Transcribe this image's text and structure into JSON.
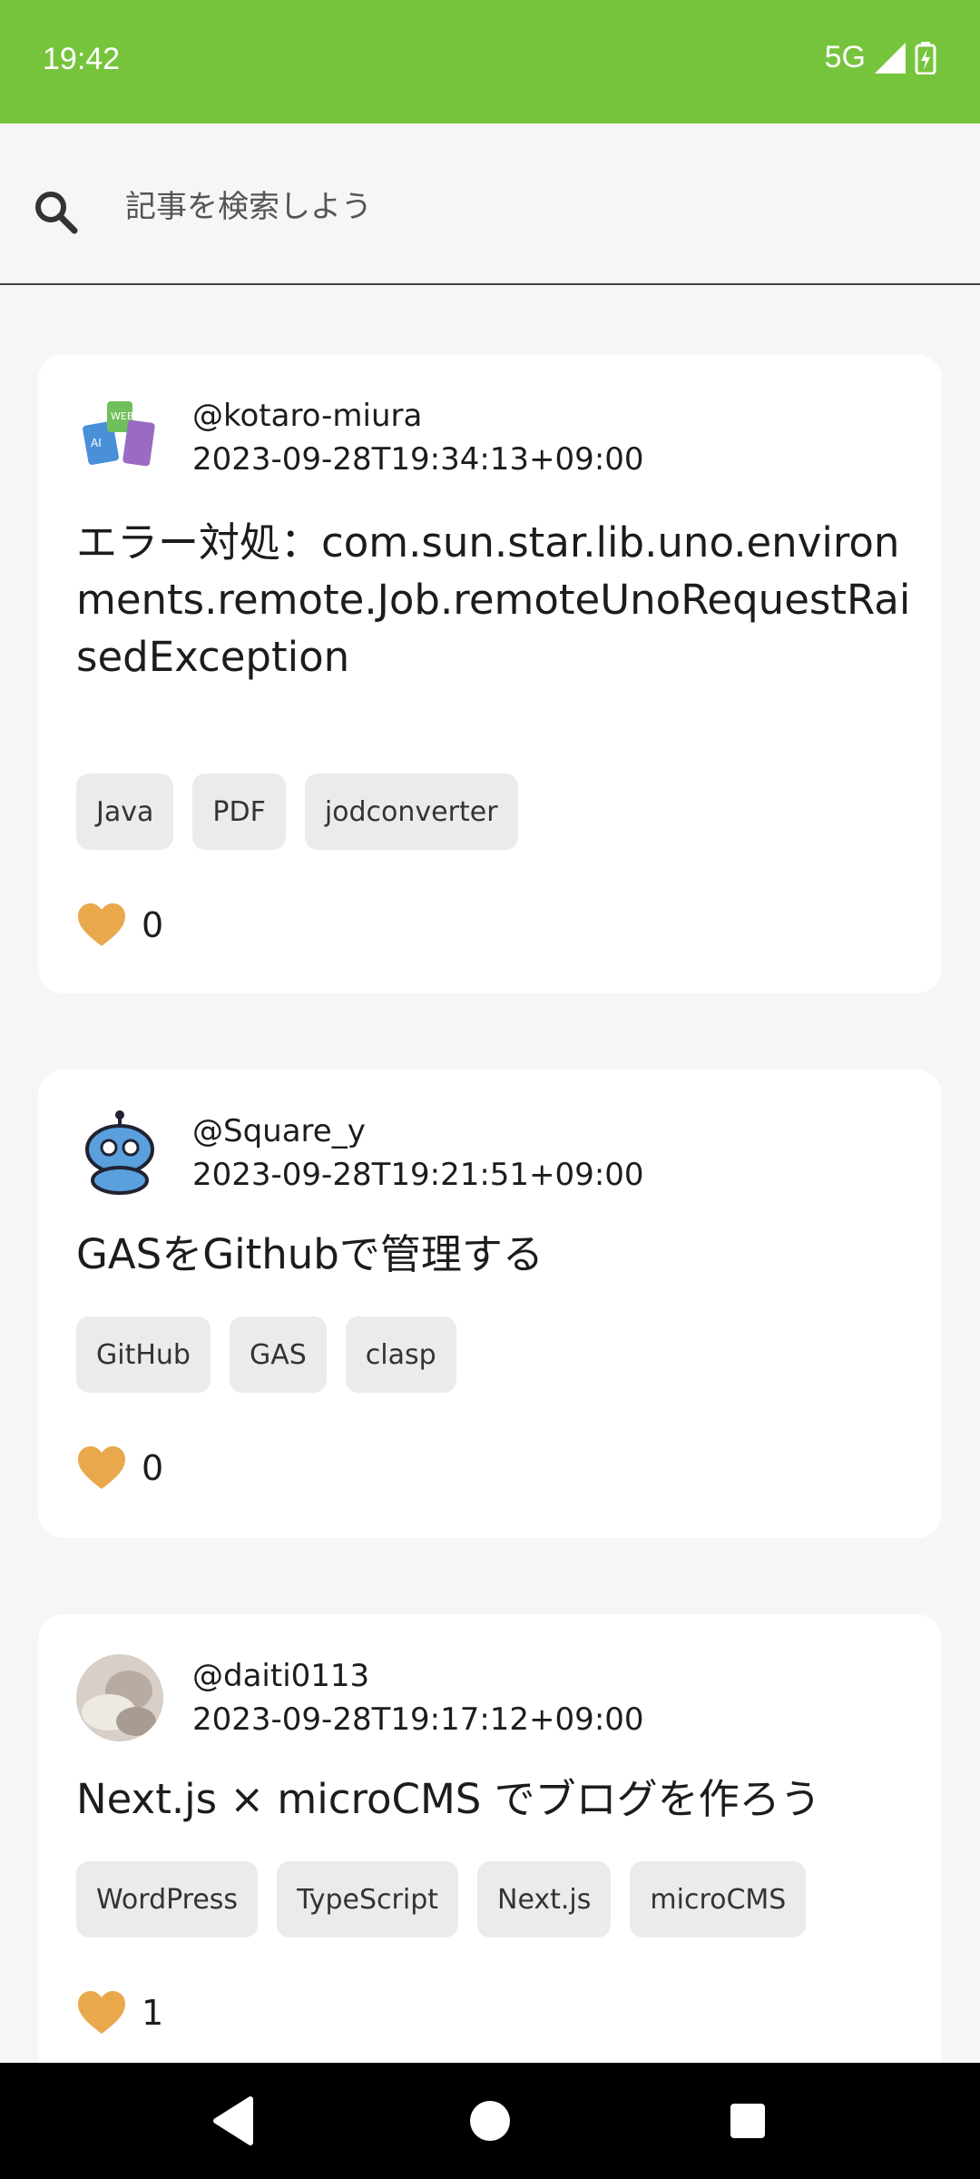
{
  "status_bar": {
    "time": "19:42",
    "network": "5G",
    "background_color": "#76c43c"
  },
  "search": {
    "placeholder": "記事を検索しよう",
    "value": ""
  },
  "posts": [
    {
      "user": "@kotaro-miura",
      "date": "2023-09-28T19:34:13+09:00",
      "title": "エラー対処：com.sun.star.lib.uno.environments.remote.Job.remoteUnoRequestRaisedException",
      "tags": [
        "Java",
        "PDF",
        "jodconverter"
      ],
      "likes": "0"
    },
    {
      "user": "@Square_y",
      "date": "2023-09-28T19:21:51+09:00",
      "title": "GASをGithubで管理する",
      "tags": [
        "GitHub",
        "GAS",
        "clasp"
      ],
      "likes": "0"
    },
    {
      "user": "@daiti0113",
      "date": "2023-09-28T19:17:12+09:00",
      "title": "Next.js × microCMS でブログを作ろう",
      "tags": [
        "WordPress",
        "TypeScript",
        "Next.js",
        "microCMS"
      ],
      "likes": "1"
    }
  ],
  "colors": {
    "like_heart": "#e9a84c",
    "tag_background": "#ebebeb"
  },
  "icons": {
    "search": "search-icon",
    "like": "heart-icon",
    "back": "back-triangle-icon",
    "home": "home-circle-icon",
    "recents": "recents-square-icon"
  }
}
